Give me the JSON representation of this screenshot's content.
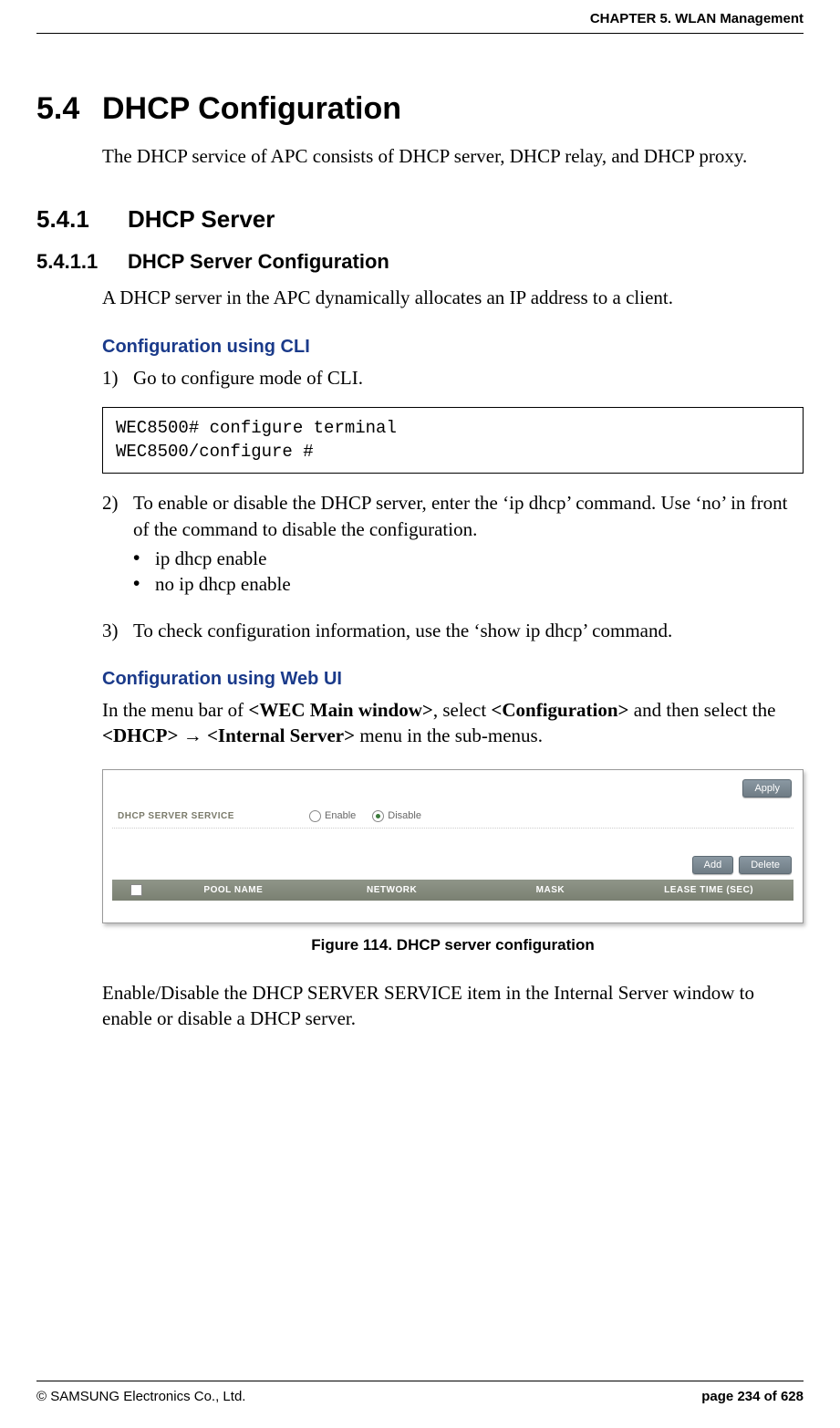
{
  "header": {
    "chapter": "CHAPTER 5. WLAN Management"
  },
  "section": {
    "num": "5.4",
    "title": "DHCP Configuration",
    "intro": "The DHCP service of APC consists of DHCP server, DHCP relay, and DHCP proxy."
  },
  "sub": {
    "num": "5.4.1",
    "title": "DHCP Server"
  },
  "subsub": {
    "num": "5.4.1.1",
    "title": "DHCP Server Configuration",
    "intro": "A DHCP server in the APC dynamically allocates an IP address to a client."
  },
  "cli": {
    "heading": "Configuration using CLI",
    "step1_marker": "1)",
    "step1_text": "Go to configure mode of CLI.",
    "code": "WEC8500# configure terminal\nWEC8500/configure #",
    "step2_marker": "2)",
    "step2_text": "To enable or disable the DHCP server, enter the ‘ip dhcp’ command. Use ‘no’ in front of the command to disable the configuration.",
    "step2_b1": "ip dhcp enable",
    "step2_b2": "no ip dhcp enable",
    "step3_marker": "3)",
    "step3_text": "To check configuration information, use the ‘show ip dhcp’ command."
  },
  "webui": {
    "heading": "Configuration using Web UI",
    "nav_prefix": "In the menu bar of ",
    "nav_wec": "<WEC Main window>",
    "nav_mid1": ", select ",
    "nav_conf": "<Configuration>",
    "nav_mid2": " and then select the ",
    "nav_dhcp": "<DHCP>",
    "nav_arrow": " → ",
    "nav_is": "<Internal Server>",
    "nav_suffix": " menu in the sub-menus."
  },
  "screenshot": {
    "apply": "Apply",
    "service_label": "DHCP SERVER SERVICE",
    "enable": "Enable",
    "disable": "Disable",
    "add": "Add",
    "delete": "Delete",
    "cols": {
      "pool": "POOL NAME",
      "network": "NETWORK",
      "mask": "MASK",
      "lease": "LEASE TIME (SEC)"
    }
  },
  "figure": {
    "caption": "Figure 114. DHCP server configuration"
  },
  "closing": "Enable/Disable the DHCP SERVER SERVICE item in the Internal Server window to enable or disable a DHCP server.",
  "footer": {
    "copyright": "© SAMSUNG Electronics Co., Ltd.",
    "page": "page 234 of 628"
  }
}
